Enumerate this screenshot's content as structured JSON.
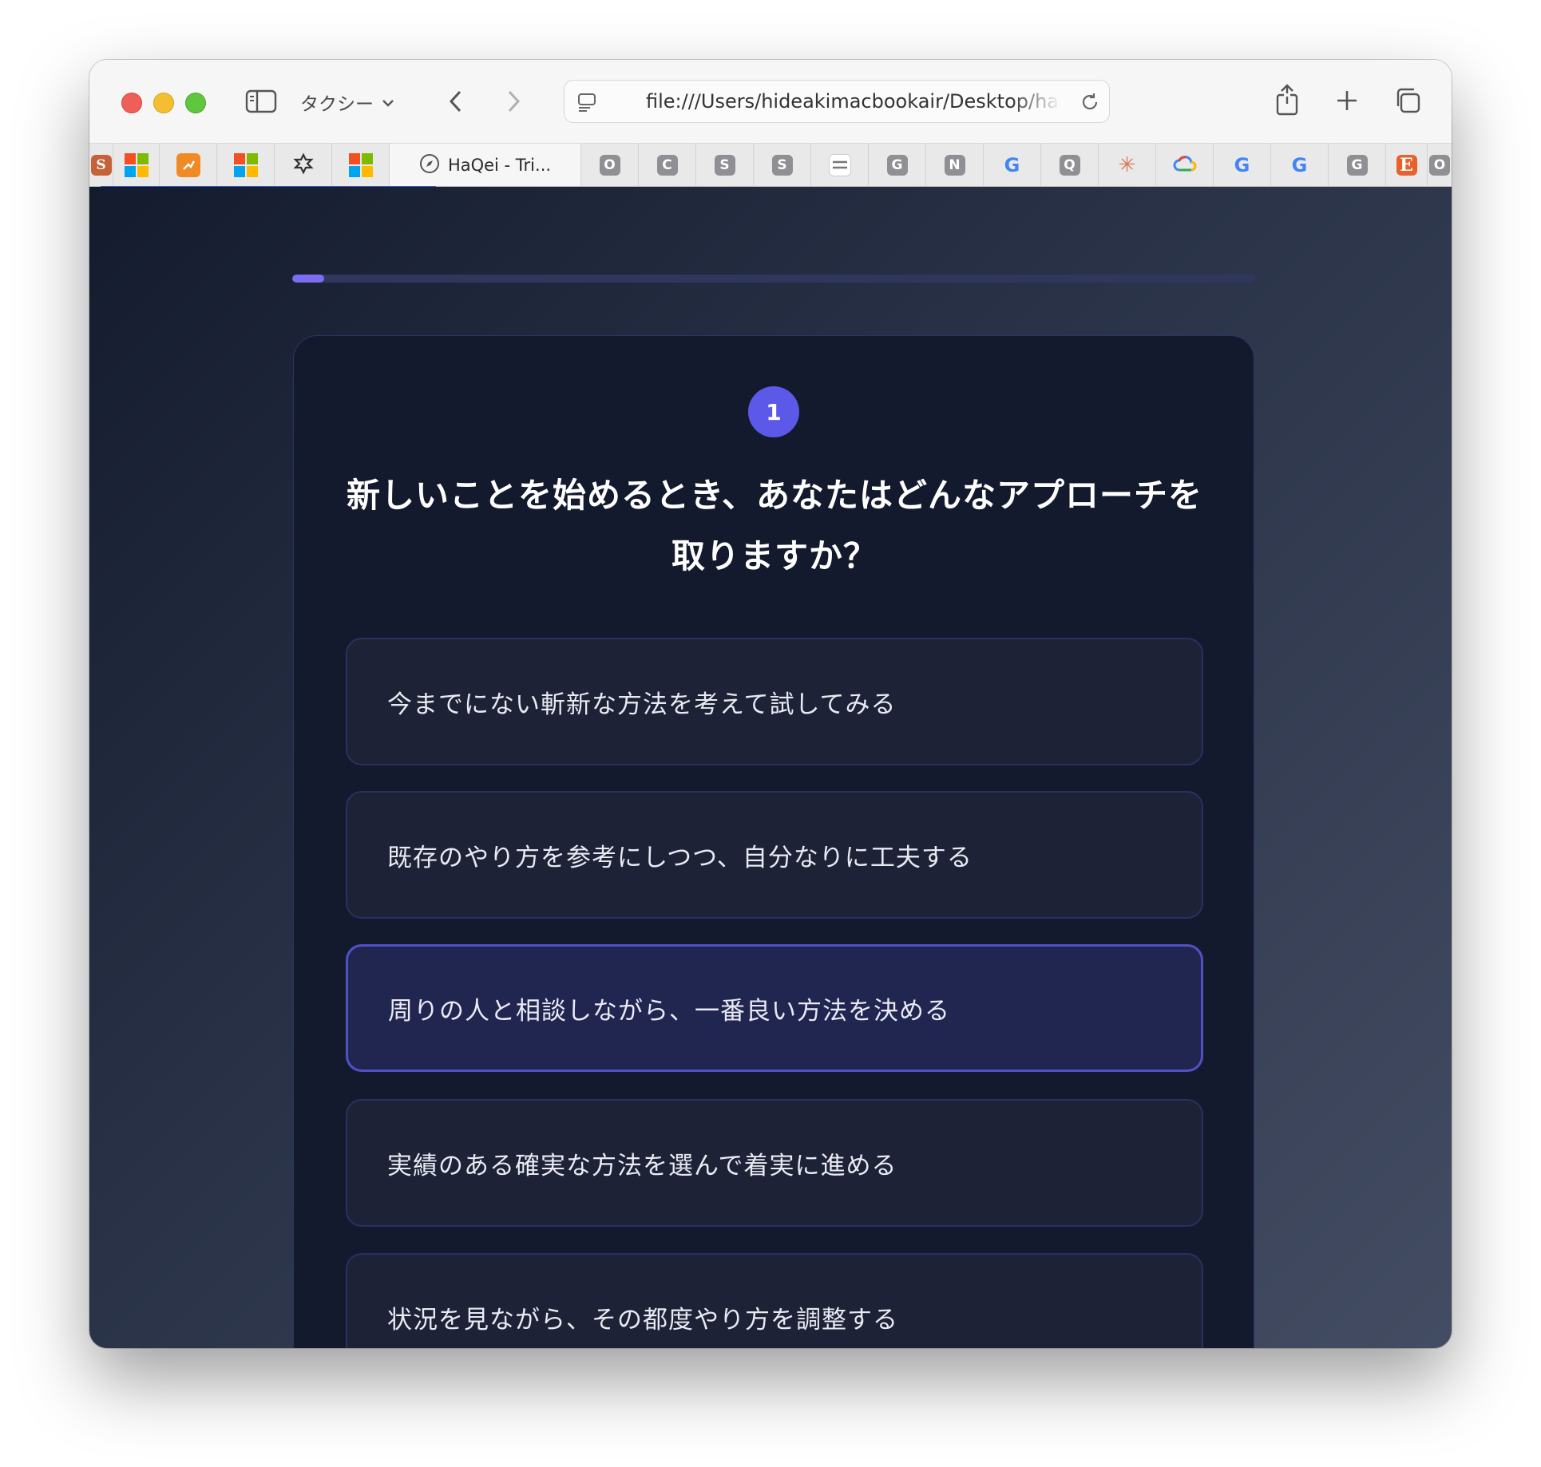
{
  "browser": {
    "profile_label": "タクシー",
    "url": "file:///Users/hideakimacbookair/Desktop/haqei",
    "active_tab_title": "HaQei - Tri...",
    "pinned_tabs": [
      {
        "icon": "s-logo-icon",
        "letter": "S"
      },
      {
        "icon": "microsoft-icon"
      },
      {
        "icon": "orange-app-icon"
      },
      {
        "icon": "microsoft-icon"
      },
      {
        "icon": "puzzle-icon"
      },
      {
        "icon": "microsoft-icon"
      }
    ],
    "tabs": [
      {
        "icon": "letter-icon",
        "letter": "O"
      },
      {
        "icon": "letter-icon",
        "letter": "C"
      },
      {
        "icon": "letter-icon",
        "letter": "S"
      },
      {
        "icon": "letter-icon",
        "letter": "S"
      },
      {
        "icon": "lines-icon",
        "letter": ""
      },
      {
        "icon": "letter-icon",
        "letter": "G"
      },
      {
        "icon": "letter-icon",
        "letter": "N"
      },
      {
        "icon": "google-icon",
        "letter": "G"
      },
      {
        "icon": "letter-icon",
        "letter": "Q"
      },
      {
        "icon": "claude-starburst-icon",
        "letter": "✳"
      },
      {
        "icon": "google-cloud-icon",
        "letter": ""
      },
      {
        "icon": "google-icon",
        "letter": "G"
      },
      {
        "icon": "google-icon",
        "letter": "G"
      },
      {
        "icon": "letter-icon",
        "letter": "G"
      },
      {
        "icon": "etsy-icon",
        "letter": "E"
      },
      {
        "icon": "letter-icon",
        "letter": "O"
      }
    ]
  },
  "quiz": {
    "progress": 0.033,
    "question_number": "1",
    "question": "新しいことを始めるとき、あなたはどんなアプローチを取りますか？",
    "options": [
      {
        "label": "今までにない斬新な方法を考えて試してみる",
        "selected": false
      },
      {
        "label": "既存のやり方を参考にしつつ、自分なりに工夫する",
        "selected": false
      },
      {
        "label": "周りの人と相談しながら、一番良い方法を決める",
        "selected": true
      },
      {
        "label": "実績のある確実な方法を選んで着実に進める",
        "selected": false
      },
      {
        "label": "状況を見ながら、その都度やり方を調整する",
        "selected": false
      }
    ]
  },
  "colors": {
    "accent": "#5c59e8",
    "progress_fill": "#7b6cf0",
    "card_bg": "#141a2e",
    "option_bg": "#1d2236"
  }
}
